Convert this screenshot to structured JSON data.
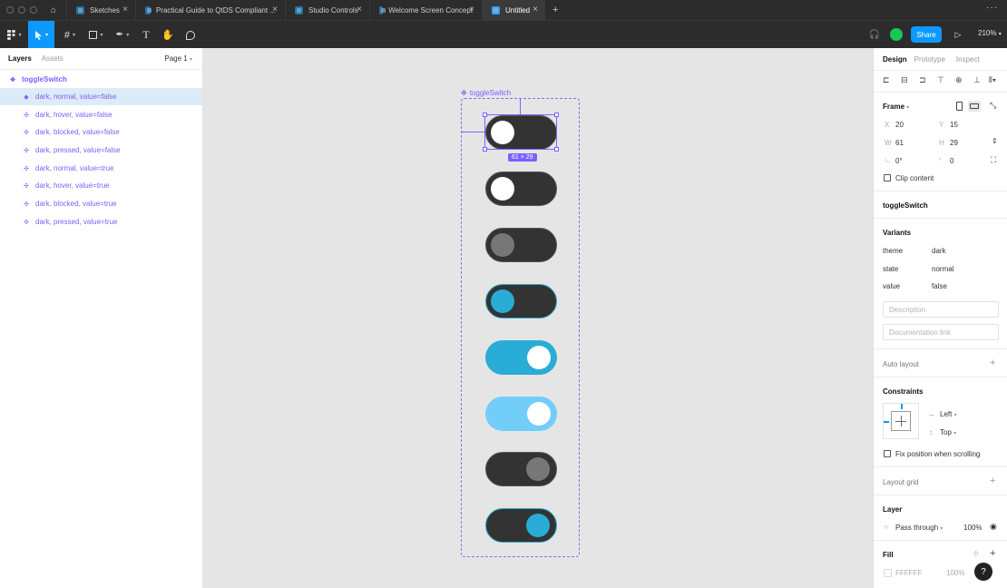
{
  "tabs": [
    {
      "label": "Sketches"
    },
    {
      "label": "Practical Guide to QtDS Compliant ..."
    },
    {
      "label": "Studio Controls"
    },
    {
      "label": "Welcome Screen Concept"
    },
    {
      "label": "Untitled"
    }
  ],
  "toolbar": {
    "share_label": "Share",
    "zoom": "210%"
  },
  "left_panel": {
    "tab_layers": "Layers",
    "tab_assets": "Assets",
    "page": "Page 1",
    "root": "toggleSwitch",
    "layers": [
      "dark, normal, value=false",
      "dark, hover, value=false",
      "dark, blocked, value=false",
      "dark, pressed, value=false",
      "dark, normal, value=true",
      "dark, hover, value=true",
      "dark, blocked, value=true",
      "dark, pressed, value=true"
    ]
  },
  "canvas": {
    "component_label": "toggleSwitch",
    "size_badge": "61 × 29"
  },
  "right_panel": {
    "tab_design": "Design",
    "tab_prototype": "Prototype",
    "tab_inspect": "Inspect",
    "frame_label": "Frame",
    "x_label": "X",
    "x_value": "20",
    "y_label": "Y",
    "y_value": "15",
    "w_label": "W",
    "w_value": "61",
    "h_label": "H",
    "h_value": "29",
    "rotation": "0°",
    "radius": "0",
    "clip_content": "Clip content",
    "component_name": "toggleSwitch",
    "variants_title": "Variants",
    "variants": [
      {
        "key": "theme",
        "value": "dark"
      },
      {
        "key": "state",
        "value": "normal"
      },
      {
        "key": "value",
        "value": "false"
      }
    ],
    "description_placeholder": "Description",
    "doc_link_placeholder": "Documentation link",
    "auto_layout": "Auto layout",
    "constraints": "Constraints",
    "constraint_h": "Left",
    "constraint_v": "Top",
    "fix_position": "Fix position when scrolling",
    "layout_grid": "Layout grid",
    "layer_title": "Layer",
    "blend_mode": "Pass through",
    "opacity": "100%",
    "fill_title": "Fill",
    "fill_hex": "FFFFFF",
    "fill_opacity": "100%"
  },
  "colors": {
    "accent": "#0d99ff",
    "component": "#7b61ff",
    "toggle_on": "#29acd6",
    "toggle_hover_on": "#72cef9"
  }
}
